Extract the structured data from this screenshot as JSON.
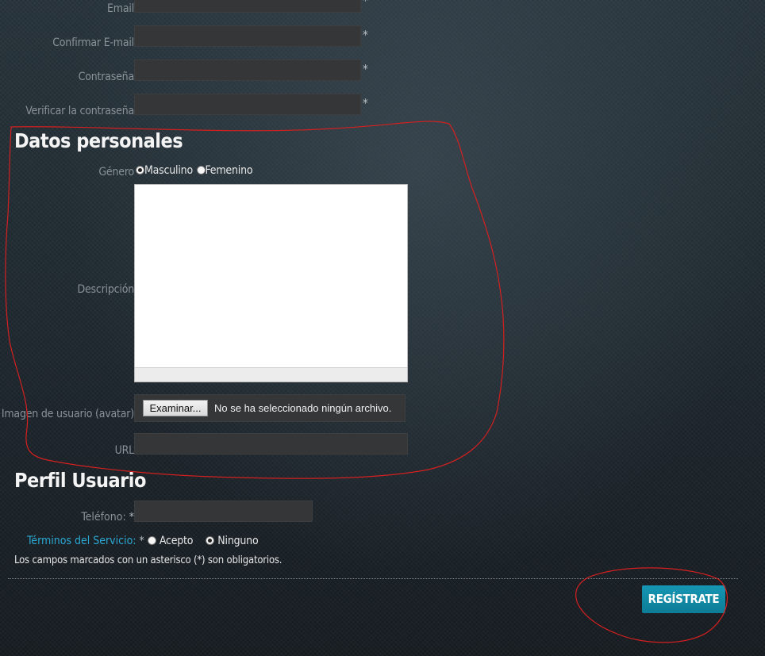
{
  "account": {
    "email_label": "Email",
    "confirm_email_label": "Confirmar E-mail",
    "password_label": "Contraseña",
    "verify_password_label": "Verificar la contraseña",
    "required_mark": "*"
  },
  "personal": {
    "title": "Datos personales",
    "gender_label": "Género",
    "gender_options": [
      {
        "label": "Masculino",
        "selected": true
      },
      {
        "label": "Femenino",
        "selected": false
      }
    ],
    "description_label": "Descripción",
    "avatar_label": "Imagen de usuario (avatar)",
    "file_button": "Examinar...",
    "file_status": "No se ha seleccionado ningún archivo.",
    "url_label": "URL"
  },
  "profile": {
    "title": "Perfil Usuario",
    "phone_label": "Teléfono:",
    "terms_label": "Términos del Servicio:",
    "terms_options": [
      {
        "label": "Acepto",
        "selected": false
      },
      {
        "label": "Ninguno",
        "selected": true
      }
    ],
    "required_note": "Los campos marcados con un asterisco (*) son obligatorios."
  },
  "submit": {
    "label": "REGÍSTRATE"
  },
  "colors": {
    "accent": "#1590ad",
    "link": "#2aa7d1",
    "annotation": "#d42020"
  }
}
